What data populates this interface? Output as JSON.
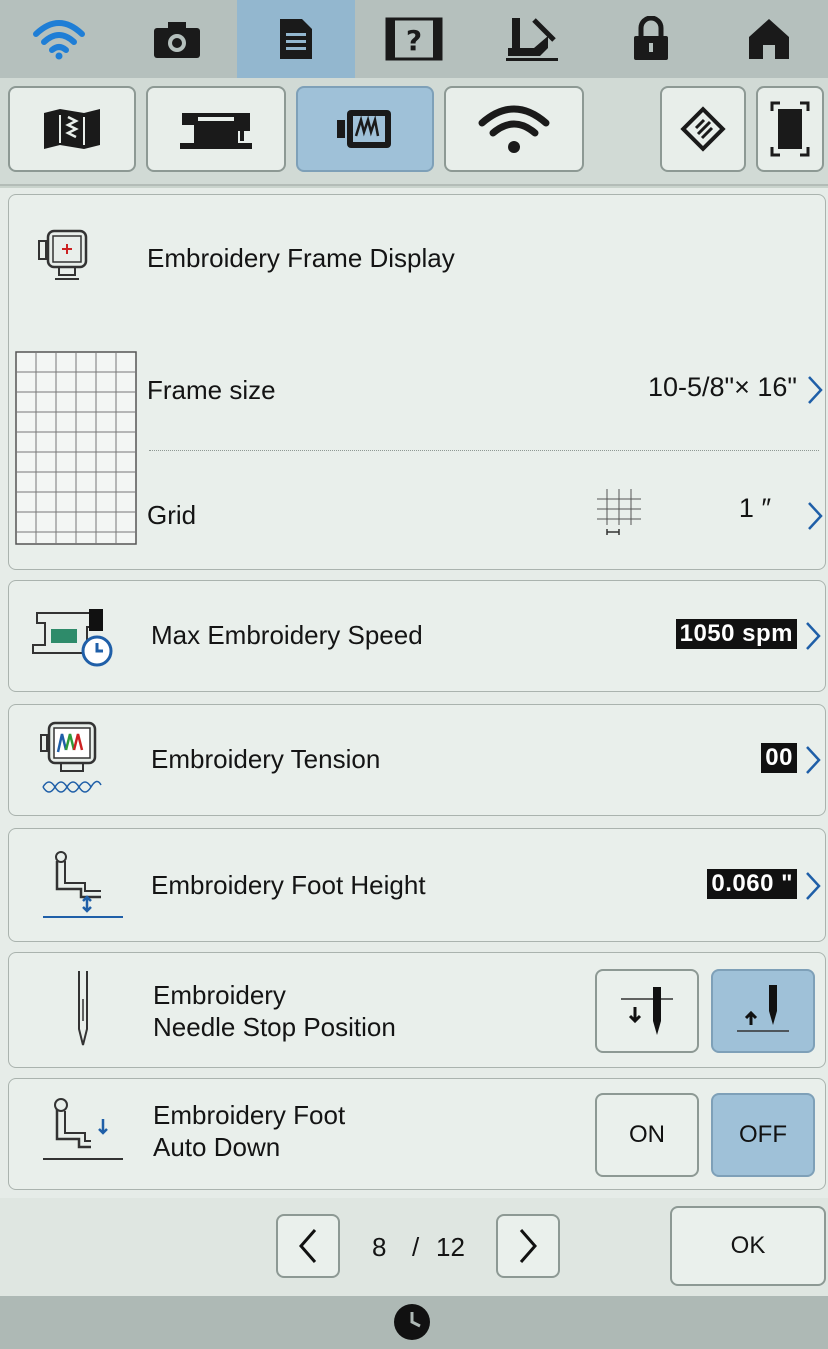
{
  "top_tabs": [
    {
      "icon": "wifi-icon"
    },
    {
      "icon": "camera-icon"
    },
    {
      "icon": "document-icon",
      "active": true
    },
    {
      "icon": "help-icon"
    },
    {
      "icon": "presser-foot-icon"
    },
    {
      "icon": "lock-icon"
    },
    {
      "icon": "home-icon"
    }
  ],
  "category_tabs": [
    {
      "icon": "general-settings-icon"
    },
    {
      "icon": "sewing-settings-icon"
    },
    {
      "icon": "embroidery-settings-icon",
      "active": true
    },
    {
      "icon": "wireless-settings-icon"
    },
    {
      "icon": "projector-settings-icon"
    },
    {
      "icon": "screen-settings-icon"
    }
  ],
  "settings": {
    "frame_display": {
      "label": "Embroidery Frame Display"
    },
    "frame_size": {
      "label": "Frame size",
      "value": "10-5/8\"× 16\""
    },
    "grid": {
      "label": "Grid",
      "value": "1 ″"
    },
    "max_speed": {
      "label": "Max Embroidery Speed",
      "value": "1050 spm"
    },
    "tension": {
      "label": "Embroidery Tension",
      "value": "00"
    },
    "foot_height": {
      "label": "Embroidery Foot Height",
      "value": "0.060 \""
    },
    "needle_stop": {
      "label_line1": "Embroidery",
      "label_line2": "Needle Stop Position",
      "selected": "up"
    },
    "foot_auto_down": {
      "label_line1": "Embroidery Foot",
      "label_line2": "Auto Down",
      "on_label": "ON",
      "off_label": "OFF",
      "selected": "OFF"
    }
  },
  "pager": {
    "current": "8",
    "separator": "/",
    "total": "12",
    "ok_label": "OK"
  },
  "colors": {
    "active_tab": "#9fc1d8",
    "inverted_value_bg": "#111111",
    "frame_red": "#cc2222"
  }
}
